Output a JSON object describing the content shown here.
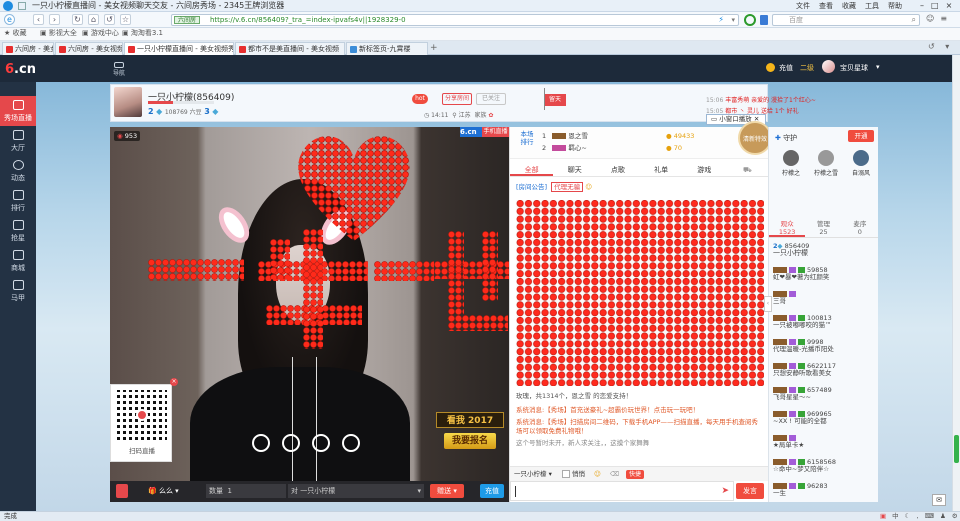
{
  "browser": {
    "title": "一只小柠檬直播间 - 美女视频聊天交友 - 六间房秀场 - 2345王牌浏览器",
    "menu": [
      "文件",
      "查看",
      "收藏",
      "工具",
      "帮助"
    ],
    "secure_label": "六间房",
    "url": "https://v.6.cn/856409?_tra_=index-ipvafs4v||1928329-0",
    "search_placeholder": "百度",
    "bookmarks": [
      "收藏",
      "影视大全",
      "游戏中心",
      "淘淘看3.1"
    ],
    "tabs": [
      {
        "label": "六间房 - 美女视频 - 美女直播"
      },
      {
        "label": "六间房 - 美女视频 - 美女直播"
      },
      {
        "label": "一只小柠檬直播间 - 美女视频秀"
      },
      {
        "label": "都市不是美直播间 - 美女视频"
      },
      {
        "label": "新标签页-九霄楼"
      }
    ],
    "status_left": "完成"
  },
  "site": {
    "logo_six": "6",
    "logo_cn": ".cn",
    "nav_button": "导航",
    "user_area": {
      "charge": "充值",
      "level": "二级",
      "username": "宝贝星球"
    },
    "sidebar": [
      {
        "label": "秀场直播",
        "active": true
      },
      {
        "label": "大厅"
      },
      {
        "label": "动态"
      },
      {
        "label": "排行"
      },
      {
        "label": "抢星"
      },
      {
        "label": "商城"
      },
      {
        "label": "马甲"
      }
    ],
    "host": {
      "name": "一只小柠檬",
      "room_id": "(856409)",
      "level_left": "2",
      "level_right": "3",
      "fans": "108769 六豆",
      "time": "14:11",
      "location": "江苏",
      "family": "家族",
      "hot_badge": "hot",
      "share_btn": "分享房间",
      "follow_btn": "已关注",
      "flag": "留天"
    },
    "notices": [
      {
        "time": "15:06",
        "text": "丰富秀萌 亲爱的 漫拾了1个红心~"
      },
      {
        "time": "15:05",
        "text": "都市 丶 灵儿 送给 1个 好礼"
      }
    ],
    "mini_window": "小窗口播放",
    "charity_badge": "清新特效",
    "video": {
      "viewers": "953",
      "watermark": "6.cn",
      "phone_tag": "手机直播",
      "overlay_text": [
        "一",
        "生",
        "一",
        "世"
      ],
      "qr_caption": "扫码直播",
      "promo_top": "看我 2017",
      "promo_btn": "我要报名",
      "controls": {
        "gift_count_label": "数量",
        "gift_count": "1",
        "target": "一只小柠檬",
        "send_gift": "赠送",
        "charge": "充值"
      },
      "fun_label": "么么"
    },
    "rank": {
      "title": "本场",
      "subtitle": "排行",
      "rows": [
        {
          "rank": "1",
          "name": "恩之雪",
          "score": "49433"
        },
        {
          "rank": "2",
          "name": "羁心~",
          "score": "70"
        }
      ]
    },
    "chat": {
      "tabs": [
        "全部",
        "聊天",
        "点歌",
        "礼单",
        "游戏"
      ],
      "announce_label": "[房间公告]",
      "announce_link": "代理无骗",
      "gift_line": "玫瑰，共1314个，恩之雪 的恋爱支持！",
      "sys_msgs": [
        "系统消息:【秀场】首充送豪礼~超霸价玩世界！点击玩一玩吧！",
        "系统消息:【秀场】扫描房间二维码，下载手机APP——扫描直播，每天用手机查阅秀场可以领取免费礼物哦！",
        "这个号暂时未开，新人求关注，，这摸个家舞舞"
      ],
      "to_label": "一只小柠檬",
      "private_label": "悄悄",
      "input_placeholder": "",
      "send_btn": "发言",
      "quick_label": "快捷"
    },
    "guard": {
      "title": "守护",
      "open_btn": "开通",
      "members": [
        "柠檬之",
        "柠檬之雪",
        "自溺风"
      ]
    },
    "audience": {
      "tabs": [
        {
          "label": "观众",
          "count": "1523"
        },
        {
          "label": "管理",
          "count": "25"
        },
        {
          "label": "麦序",
          "count": "0"
        }
      ],
      "host_line": "一只小柠檬",
      "host_id": "856409",
      "users": [
        {
          "id": "59858",
          "name": "虹❤暴❤著为红颜笑"
        },
        {
          "id": "",
          "name": "三哥"
        },
        {
          "id": "100813",
          "name": "一只被嘟嘟咬的猫™"
        },
        {
          "id": "9998",
          "name": "代理温暖-光播币阳处"
        },
        {
          "id": "6622117",
          "name": "只想安静听歌看美女"
        },
        {
          "id": "657489",
          "name": "飞哥星星〜~"
        },
        {
          "id": "969965",
          "name": "~XX ! 可能的全都"
        },
        {
          "id": "",
          "name": "★局单卡★"
        },
        {
          "id": "6158568",
          "name": "☆命中~梦又陪伴☆"
        },
        {
          "id": "96283",
          "name": "一生"
        }
      ]
    }
  },
  "colors": {
    "brand_red": "#e5484b",
    "dark_nav": "#1d2a3a",
    "blue": "#1e9be8"
  }
}
